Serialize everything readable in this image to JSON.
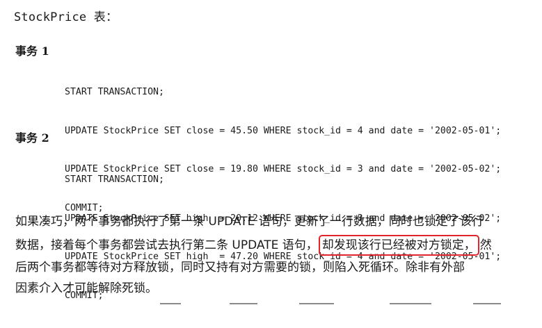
{
  "title": "StockPrice 表：",
  "transactions": [
    {
      "label": "事务 1",
      "lines": [
        "START TRANSACTION;",
        "UPDATE StockPrice SET close = 45.50 WHERE stock_id = 4 and date = '2002-05-01';",
        "UPDATE StockPrice SET close = 19.80 WHERE stock_id = 3 and date = '2002-05-02';",
        "COMMIT;"
      ]
    },
    {
      "label": "事务 2",
      "lines": [
        "START TRANSACTION;",
        "UPDATE StockPrice SET high  = 20.12 WHERE stock_id = 3 and date = '2002-05-02';",
        "UPDATE StockPrice SET high  = 47.20 WHERE stock_id = 4 and date = '2002-05-01';",
        "COMMIT;"
      ]
    }
  ],
  "paragraph": {
    "line1": "如果凑巧，两个事务都执行了第一条 UPDATE 语句，更新了一行数据，同时也锁定了该行",
    "line2_before": "数据，接着每个事务都尝试去执行第二条 UPDATE 语句，",
    "line2_highlight": "却发现该行已经被对方锁定，",
    "line2_after": "然",
    "line3": "后两个事务都等待对方释放锁，同时又持有对方需要的锁，则陷入死循环。除非有外部",
    "line4": "因素介入才可能解除死锁。"
  },
  "colors": {
    "text": "#1a1a1a",
    "highlight_border": "#e0242a"
  }
}
